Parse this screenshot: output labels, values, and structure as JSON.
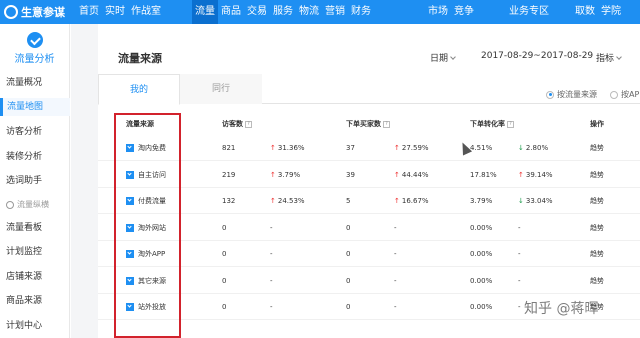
{
  "app": {
    "title": "生意参谋"
  },
  "nav": {
    "items": [
      {
        "label": "首页"
      },
      {
        "label": "实时"
      },
      {
        "label": "作战室"
      },
      {
        "label": "流量",
        "active": true
      },
      {
        "label": "商品"
      },
      {
        "label": "交易"
      },
      {
        "label": "服务"
      },
      {
        "label": "物流"
      },
      {
        "label": "营销"
      },
      {
        "label": "财务"
      },
      {
        "label": "市场"
      },
      {
        "label": "竞争"
      },
      {
        "label": "业务专区"
      },
      {
        "label": "取数"
      },
      {
        "label": "学院"
      }
    ]
  },
  "sidebar": {
    "title": "流量分析",
    "items": [
      {
        "label": "流量概况"
      },
      {
        "label": "流量地图",
        "active": true
      },
      {
        "label": "访客分析"
      },
      {
        "label": "装修分析"
      },
      {
        "label": "选词助手"
      }
    ],
    "group_label": "流量纵横",
    "group_items": [
      {
        "label": "流量看板"
      },
      {
        "label": "计划监控"
      },
      {
        "label": "店铺来源"
      },
      {
        "label": "商品来源"
      },
      {
        "label": "计划中心"
      }
    ]
  },
  "main": {
    "title": "流量来源",
    "date_label": "日期",
    "date_range": "2017-08-29~2017-08-29",
    "metric_label": "指标",
    "tabs": [
      {
        "label": "我的",
        "active": true
      },
      {
        "label": "同行"
      }
    ],
    "radios": [
      {
        "label": "按流量来源",
        "selected": true
      },
      {
        "label": "按APP"
      }
    ]
  },
  "table": {
    "headers": {
      "source": "流量来源",
      "visitors": "访客数",
      "buyers": "下单买家数",
      "conversion": "下单转化率",
      "action": "操作"
    },
    "help_icon": "?",
    "rows": [
      {
        "source": "淘内免费",
        "visitors": "821",
        "v_dir": "up",
        "v_change": "31.36%",
        "buyers": "37",
        "b_dir": "up",
        "b_change": "27.59%",
        "rate": "4.51%",
        "r_dir": "down",
        "r_change": "2.80%",
        "action": "趋势"
      },
      {
        "source": "自主访问",
        "visitors": "219",
        "v_dir": "up",
        "v_change": "3.79%",
        "buyers": "39",
        "b_dir": "up",
        "b_change": "44.44%",
        "rate": "17.81%",
        "r_dir": "up",
        "r_change": "39.14%",
        "action": "趋势"
      },
      {
        "source": "付费流量",
        "visitors": "132",
        "v_dir": "up",
        "v_change": "24.53%",
        "buyers": "5",
        "b_dir": "up",
        "b_change": "16.67%",
        "rate": "3.79%",
        "r_dir": "down",
        "r_change": "33.04%",
        "action": "趋势"
      },
      {
        "source": "淘外网站",
        "visitors": "0",
        "v_dir": "",
        "v_change": "-",
        "buyers": "0",
        "b_dir": "",
        "b_change": "-",
        "rate": "0.00%",
        "r_dir": "",
        "r_change": "-",
        "action": "趋势"
      },
      {
        "source": "淘外APP",
        "visitors": "0",
        "v_dir": "",
        "v_change": "-",
        "buyers": "0",
        "b_dir": "",
        "b_change": "-",
        "rate": "0.00%",
        "r_dir": "",
        "r_change": "-",
        "action": "趋势"
      },
      {
        "source": "其它来源",
        "visitors": "0",
        "v_dir": "",
        "v_change": "-",
        "buyers": "0",
        "b_dir": "",
        "b_change": "-",
        "rate": "0.00%",
        "r_dir": "",
        "r_change": "-",
        "action": "趋势"
      },
      {
        "source": "站外投放",
        "visitors": "0",
        "v_dir": "",
        "v_change": "-",
        "buyers": "0",
        "b_dir": "",
        "b_change": "-",
        "rate": "0.00%",
        "r_dir": "",
        "r_change": "-",
        "action": "趋势"
      }
    ]
  },
  "watermark": "知乎 @蒋晖",
  "colors": {
    "brand": "#1e8ff2",
    "nav_active": "#0b6fcf",
    "up": "#e33333",
    "down": "#1a9a4a",
    "highlight": "#d2222c"
  }
}
